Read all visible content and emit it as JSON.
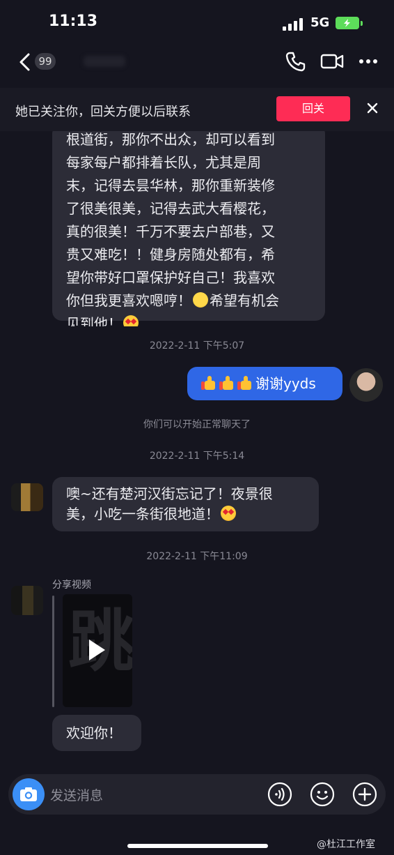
{
  "status_bar": {
    "time": "11:13",
    "network": "5G"
  },
  "header": {
    "unread_count": "99"
  },
  "follow_banner": {
    "text": "她已关注你，回关方便以后联系",
    "button": "回关"
  },
  "messages": {
    "first_lines": [
      "根道街，那你不出众，却可以看到",
      "每家每户都排着长队，尤其是周",
      "末，记得去昙华林，那你重新装修",
      "了很美很美，记得去武大看樱花，",
      "真的很美！千万不要去户部巷，又",
      "贵又难吃！！健身房随处都有，希",
      "望你带好口罩保护好自己！我喜欢",
      "你但我更喜欢嗯哼！",
      "希望有机会",
      "见到他！"
    ],
    "ts1": "2022-2-11 下午5:07",
    "out_text": "谢谢yyds",
    "system_notice": "你们可以开始正常聊天了",
    "ts2": "2022-2-11 下午5:14",
    "reply_line1": "噢~还有楚河汉街忘记了！夜景很",
    "reply_line2": "美，小吃一条街很地道！",
    "ts3": "2022-2-11 下午11:09",
    "share_label": "分享视频",
    "video_overlay_text": "跳",
    "welcome": "欢迎你！"
  },
  "input": {
    "placeholder": "发送消息"
  },
  "watermark": "@杜江工作室",
  "icons": [
    "back-icon",
    "phone-icon",
    "video-call-icon",
    "more-icon",
    "close-icon",
    "camera-icon",
    "voice-icon",
    "emoji-icon",
    "plus-icon",
    "play-icon"
  ],
  "colors": {
    "accent": "#fe2c55",
    "bubble_out": "#2f67e6",
    "camera": "#3b8ff6"
  }
}
